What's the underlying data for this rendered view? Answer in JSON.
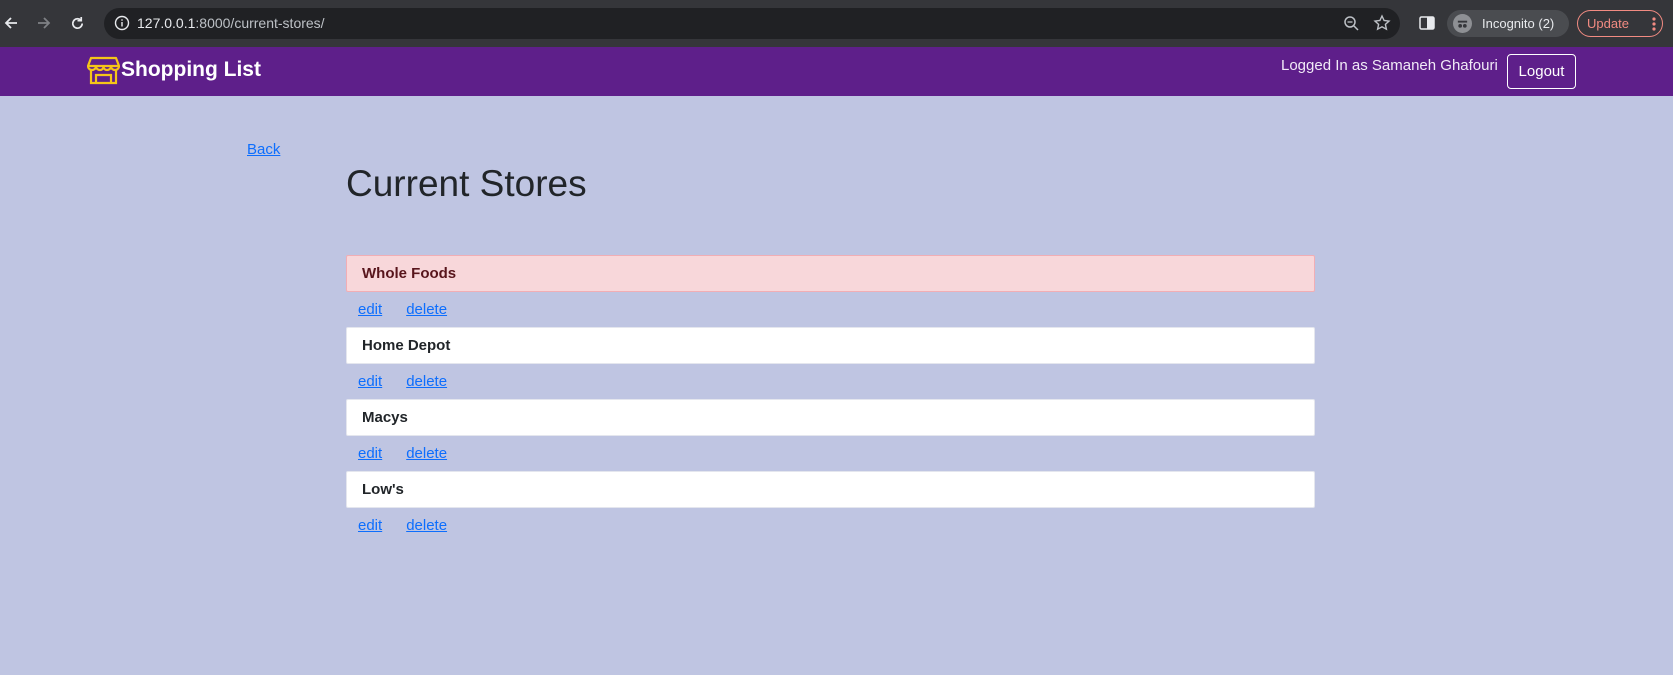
{
  "browser": {
    "url_host": "127.0.0.1",
    "url_path": ":8000/current-stores/",
    "incognito_label": "Incognito (2)",
    "update_label": "Update"
  },
  "navbar": {
    "brand": "Shopping List",
    "logged_in_text": "Logged In as Samaneh Ghafouri",
    "logout_label": "Logout",
    "brand_color": "#5e1f8a",
    "icon_color": "#f5c518"
  },
  "main": {
    "back_label": "Back",
    "title": "Current Stores",
    "edit_label": "edit",
    "delete_label": "delete",
    "stores": [
      {
        "name": "Whole Foods"
      },
      {
        "name": "Home Depot"
      },
      {
        "name": "Macys"
      },
      {
        "name": "Low's"
      }
    ]
  }
}
